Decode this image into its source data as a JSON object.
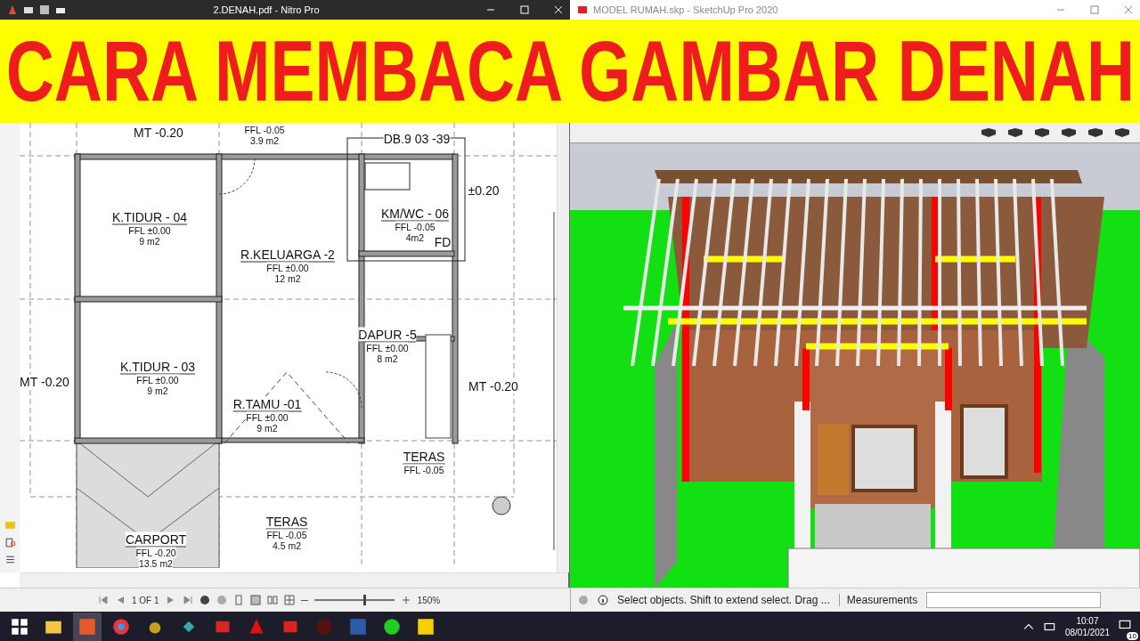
{
  "pdf_window": {
    "title": "2.DENAH.pdf - Nitro Pro"
  },
  "sketchup_window": {
    "title": "MODEL RUMAH.skp - SketchUp Pro 2020"
  },
  "banner": {
    "text": "CARA MEMBACA GAMBAR DENAH"
  },
  "floor_plan": {
    "rooms": [
      {
        "name": "K.TIDUR - 04",
        "level": "FFL ±0.00",
        "area": "9 m2"
      },
      {
        "name": "R.KELUARGA -2",
        "level": "FFL ±0.00",
        "area": "12 m2"
      },
      {
        "name": "KM/WC - 06",
        "level": "FFL -0.05",
        "area": "4m2"
      },
      {
        "name": "DAPUR -5",
        "level": "FFL ±0.00",
        "area": "8 m2"
      },
      {
        "name": "K.TIDUR - 03",
        "level": "FFL ±0.00",
        "area": "9 m2"
      },
      {
        "name": "R.TAMU -01",
        "level": "FFL ±0.00",
        "area": "9 m2"
      },
      {
        "name": "TERAS",
        "level": "FFL -0.05"
      },
      {
        "name": "TERAS",
        "level": "FFL -0.05",
        "area": "4.5 m2"
      },
      {
        "name": "CARPORT",
        "level": "FFL -0.20",
        "area": "13.5 m2"
      },
      {
        "level": "FFL -0.05",
        "area": "3.9 m2"
      }
    ],
    "marks": [
      "MT -0.20",
      "MT -0.20",
      "MT -0.20",
      "DB.9 03 -39",
      "±0.20",
      "FD"
    ]
  },
  "pdf_toolbar": {
    "page": "1 OF 1",
    "zoom_slider": {
      "level": 0.62
    },
    "zoom": "150%"
  },
  "sketchup_status": {
    "hint": "Select objects. Shift to extend select. Drag ...",
    "measurements_label": "Measurements"
  },
  "taskbar": {
    "time": "10:07",
    "date": "08/01/2021",
    "notifications": "10"
  }
}
